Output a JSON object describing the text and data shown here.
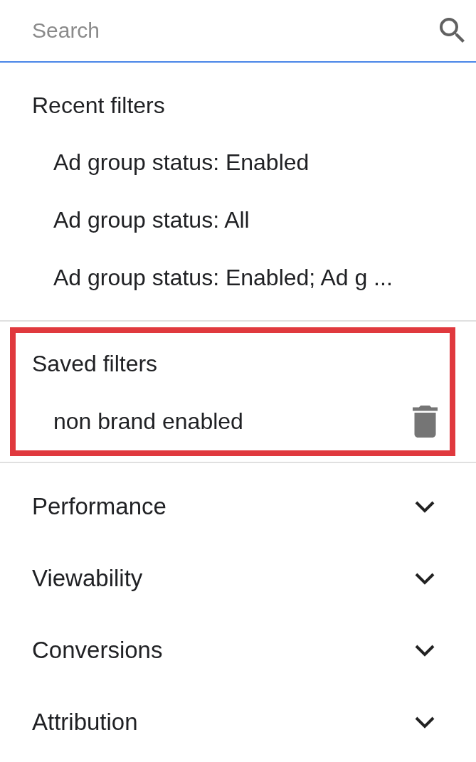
{
  "search": {
    "placeholder": "Search"
  },
  "recent_filters": {
    "title": "Recent filters",
    "items": [
      {
        "label": "Ad group status: Enabled"
      },
      {
        "label": "Ad group status: All"
      },
      {
        "label": "Ad group status: Enabled; Ad g ..."
      }
    ]
  },
  "saved_filters": {
    "title": "Saved filters",
    "highlighted": true,
    "items": [
      {
        "label": "non brand enabled"
      }
    ]
  },
  "sections": [
    {
      "label": "Performance",
      "expanded": false
    },
    {
      "label": "Viewability",
      "expanded": false
    },
    {
      "label": "Conversions",
      "expanded": false
    },
    {
      "label": "Attribution",
      "expanded": false
    }
  ]
}
